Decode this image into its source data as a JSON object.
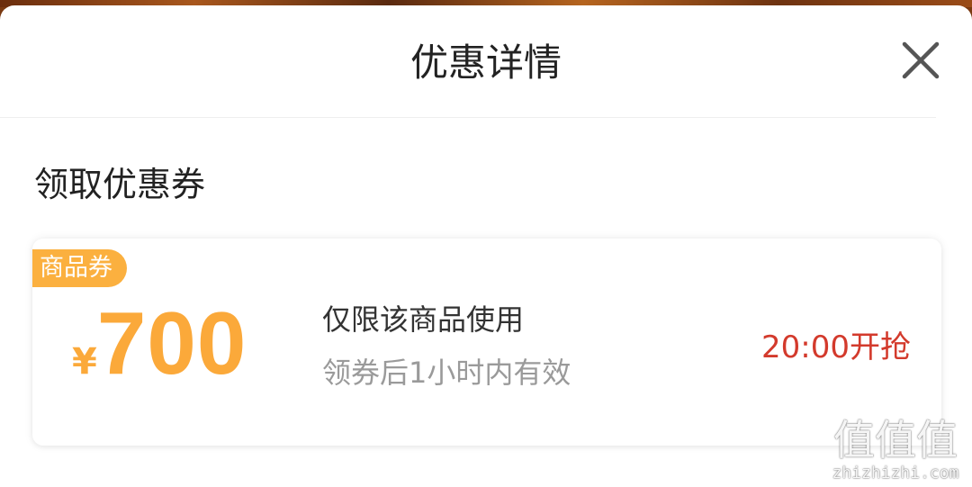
{
  "header": {
    "title": "优惠详情",
    "close_icon": "close-icon"
  },
  "section": {
    "title": "领取优惠券"
  },
  "coupon": {
    "badge": "商品券",
    "currency": "¥",
    "amount": "700",
    "description": "仅限该商品使用",
    "validity": "领券后1小时内有效",
    "start_time": "20:00开抢"
  },
  "watermark": {
    "glyphs": "值值值",
    "url": "zhizhizhi.com"
  },
  "colors": {
    "accent_orange": "#fba93a",
    "badge_orange": "#fbb03f",
    "alert_red": "#d33a2c",
    "text_primary": "#222222",
    "text_secondary": "#9a9a9a"
  }
}
